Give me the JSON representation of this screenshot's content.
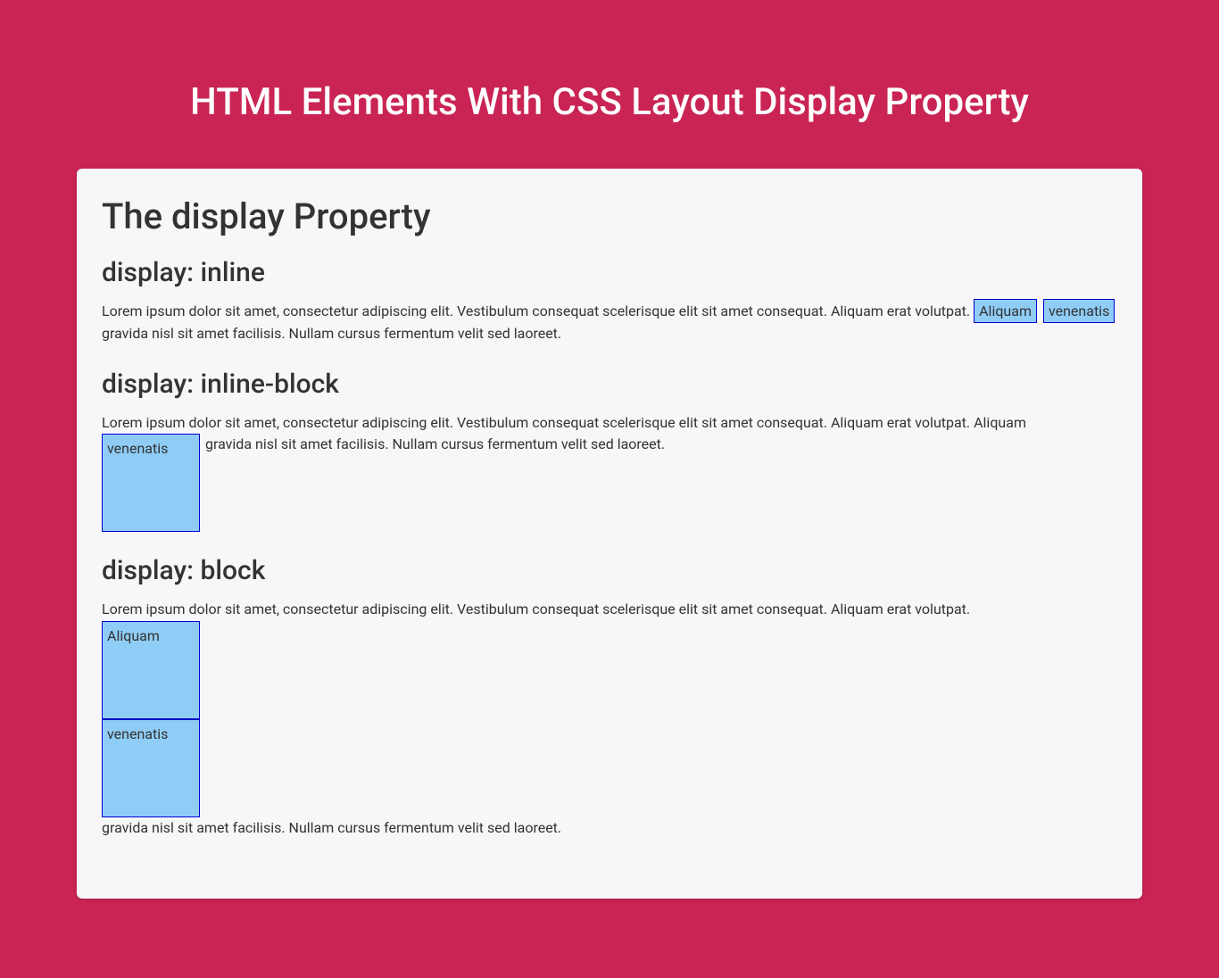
{
  "page": {
    "title": "HTML Elements With CSS Layout Display Property"
  },
  "card": {
    "heading": "The display Property",
    "sections": {
      "inline": {
        "heading": "display: inline",
        "text_before": "Lorem ipsum dolor sit amet, consectetur adipiscing elit. Vestibulum consequat scelerisque elit sit amet consequat. Aliquam erat volutpat. ",
        "box1": "Aliquam",
        "box2": "venenatis",
        "text_after": " gravida nisl sit amet facilisis. Nullam cursus fermentum velit sed laoreet."
      },
      "inline_block": {
        "heading": "display: inline-block",
        "text_before": "Lorem ipsum dolor sit amet, consectetur adipiscing elit. Vestibulum consequat scelerisque elit sit amet consequat. Aliquam erat volutpat. Aliquam ",
        "box1": "venenatis",
        "text_after": " gravida nisl sit amet facilisis. Nullam cursus fermentum velit sed laoreet."
      },
      "block": {
        "heading": "display: block",
        "text_before": "Lorem ipsum dolor sit amet, consectetur adipiscing elit. Vestibulum consequat scelerisque elit sit amet consequat. Aliquam erat volutpat. ",
        "box1": "Aliquam",
        "box2": "venenatis",
        "text_after": " gravida nisl sit amet facilisis. Nullam cursus fermentum velit sed laoreet."
      }
    }
  }
}
